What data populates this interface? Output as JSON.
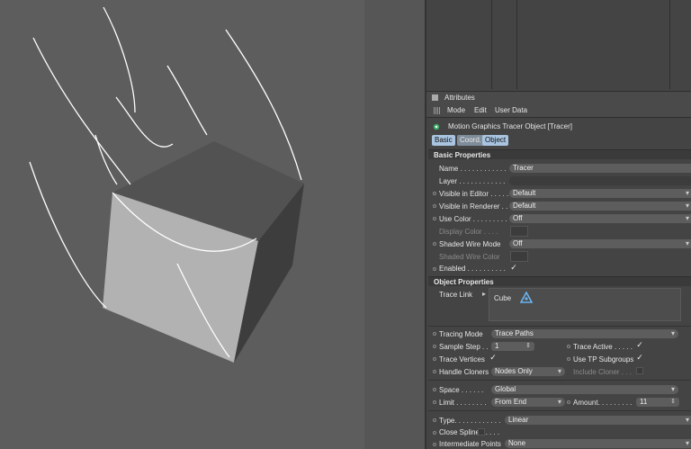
{
  "attributes_panel": {
    "title": "Attributes",
    "menu": [
      "Mode",
      "Edit",
      "User Data"
    ],
    "object_title": "Motion Graphics Tracer Object [Tracer]",
    "tabs": [
      "Basic",
      "Coord.",
      "Object"
    ],
    "basic_section": "Basic Properties",
    "basic": {
      "name_label": "Name . . . . . . . . . . . .",
      "name_value": "Tracer",
      "layer_label": "Layer . . . . . . . . . . . .",
      "visible_editor_label": "Visible in Editor . . . . .",
      "visible_editor_value": "Default",
      "visible_renderer_label": "Visible in Renderer . .",
      "visible_renderer_value": "Default",
      "use_color_label": "Use Color . . . . . . . . .",
      "use_color_value": "Off",
      "display_color_label": "Display Color . . . .",
      "shaded_wire_mode_label": "Shaded Wire Mode",
      "shaded_wire_mode_value": "Off",
      "shaded_wire_color_label": "Shaded Wire Color",
      "enabled_label": "Enabled . . . . . . . . . .",
      "enabled_checked": "✓"
    },
    "object_section": "Object Properties",
    "object": {
      "trace_link_label": "Trace Link",
      "trace_link_item": "Cube",
      "tracing_mode_label": "Tracing Mode",
      "tracing_mode_value": "Trace Paths",
      "sample_step_label": "Sample Step . .",
      "sample_step_value": "1",
      "trace_active_label": "Trace Active . . . . .",
      "trace_active_checked": "✓",
      "trace_vertices_label": "Trace Vertices",
      "trace_vertices_checked": "✓",
      "use_tp_label": "Use TP Subgroups",
      "use_tp_checked": "✓",
      "handle_cloners_label": "Handle Cloners",
      "handle_cloners_value": "Nodes Only",
      "include_cloner_label": "Include Cloner . . .",
      "space_label": "Space . . . . . .",
      "space_value": "Global",
      "limit_label": "Limit . . . . . . . .",
      "limit_value": "From End",
      "amount_label": "Amount. . . . . . . . .",
      "amount_value": "11",
      "type_label": "Type. . . . . . . . . . . .",
      "type_value": "Linear",
      "close_spline_label": "Close Spline . . . . .",
      "intermediate_label": "Intermediate Points",
      "intermediate_value": "None"
    }
  },
  "colors": {
    "viewport_bg": "#5d5d5d",
    "panel_bg": "#444444",
    "tab_active": "#a8c4e0",
    "cube_front": "#b2b2b2",
    "cube_side": "#3d3d3d",
    "cube_top": "#525252"
  },
  "icons": {
    "object_icon": "tracer-object-icon",
    "cube_icon": "cube-object-icon"
  }
}
